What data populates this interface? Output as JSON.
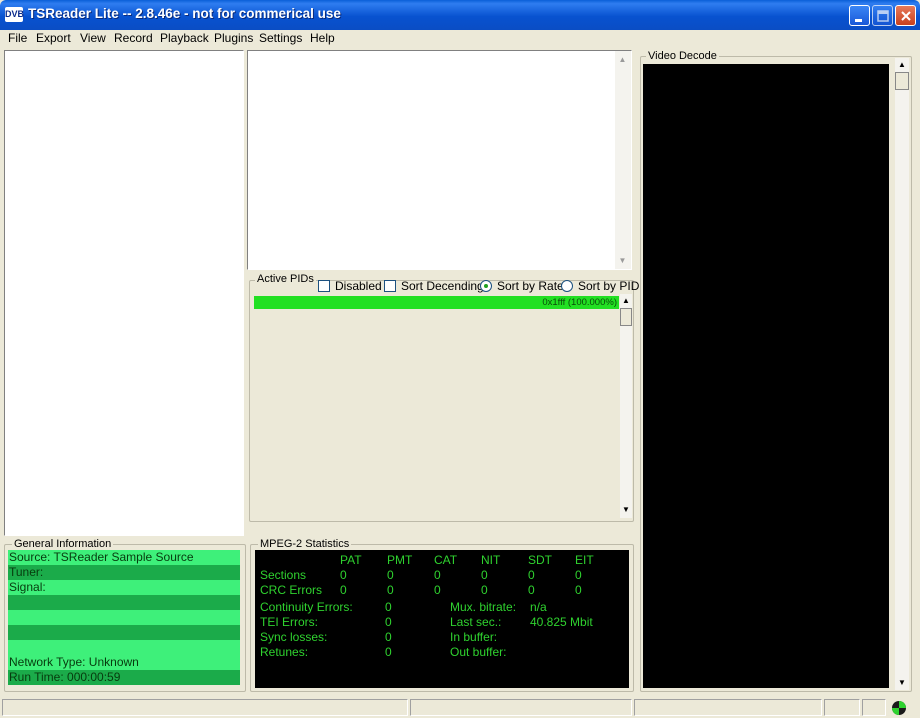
{
  "window": {
    "title": "TSReader Lite -- 2.8.46e - not for commerical use",
    "logo_text": "DVB"
  },
  "menu": [
    "File",
    "Export",
    "View",
    "Record",
    "Playback",
    "Plugins",
    "Settings",
    "Help"
  ],
  "active_pids": {
    "label": "Active PIDs",
    "options": {
      "disabled": "Disabled",
      "sort_descending": "Sort Decending",
      "sort_by_rate": "Sort by Rate",
      "sort_by_pid": "Sort by PID"
    },
    "selected_sort": "Sort by Rate",
    "bar": {
      "text": "0x1fff (100.000%)",
      "percent": 100,
      "color": "#22e022"
    }
  },
  "video_decode": {
    "label": "Video Decode"
  },
  "general_info": {
    "label": "General Information",
    "rows": [
      "Source: TSReader Sample Source",
      "Tuner:",
      "Signal:",
      "",
      "",
      "",
      "",
      "Network Type: Unknown",
      "Run Time: 000:00:59"
    ],
    "light_color": "#3ef07a",
    "dark_color": "#1bab4a"
  },
  "mpeg2_stats": {
    "label": "MPEG-2 Statistics",
    "columns": [
      "PAT",
      "PMT",
      "CAT",
      "NIT",
      "SDT",
      "EIT"
    ],
    "sections_label": "Sections",
    "sections": [
      "0",
      "0",
      "0",
      "0",
      "0",
      "0"
    ],
    "crc_label": "CRC Errors",
    "crc": [
      "0",
      "0",
      "0",
      "0",
      "0",
      "0"
    ],
    "left": [
      {
        "label": "Continuity Errors:",
        "value": "0"
      },
      {
        "label": "TEI Errors:",
        "value": "0"
      },
      {
        "label": "Sync losses:",
        "value": "0"
      },
      {
        "label": "Retunes:",
        "value": "0"
      }
    ],
    "right": [
      {
        "label": "Mux. bitrate:",
        "value": "n/a"
      },
      {
        "label": "Last sec.:",
        "value": "40.825 Mbit"
      },
      {
        "label": "In buffer:",
        "value": ""
      },
      {
        "label": "Out buffer:",
        "value": ""
      }
    ],
    "text_color": "#2fd22f"
  },
  "status_icon": "tuner-status-icon"
}
